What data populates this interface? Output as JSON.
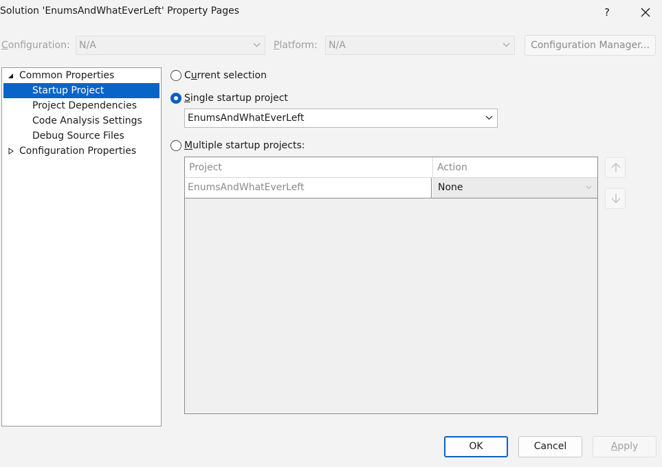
{
  "window": {
    "title": "Solution 'EnumsAndWhatEverLeft' Property Pages",
    "help_label": "?"
  },
  "config_row": {
    "configuration_label": "Configuration:",
    "configuration_value": "N/A",
    "platform_label": "Platform:",
    "platform_value": "N/A",
    "config_manager_label": "Configuration Manager..."
  },
  "tree": {
    "items": [
      {
        "label": "Common Properties",
        "level": 0,
        "expanded": true
      },
      {
        "label": "Startup Project",
        "level": 1,
        "selected": true
      },
      {
        "label": "Project Dependencies",
        "level": 1
      },
      {
        "label": "Code Analysis Settings",
        "level": 1
      },
      {
        "label": "Debug Source Files",
        "level": 1
      },
      {
        "label": "Configuration Properties",
        "level": 0,
        "expanded": false
      }
    ]
  },
  "startup": {
    "current_selection_label": "Current selection",
    "single_startup_label": "Single startup project",
    "single_startup_value": "EnumsAndWhatEverLeft",
    "multiple_startup_label": "Multiple startup projects:",
    "selected_option": "single"
  },
  "grid": {
    "columns": [
      "Project",
      "Action"
    ],
    "rows": [
      {
        "project": "EnumsAndWhatEverLeft",
        "action": "None"
      }
    ]
  },
  "buttons": {
    "ok": "OK",
    "cancel": "Cancel",
    "apply": "Apply"
  },
  "colors": {
    "accent": "#0a5fc0",
    "selection": "#0a64c8",
    "background": "#f3f3f3"
  }
}
